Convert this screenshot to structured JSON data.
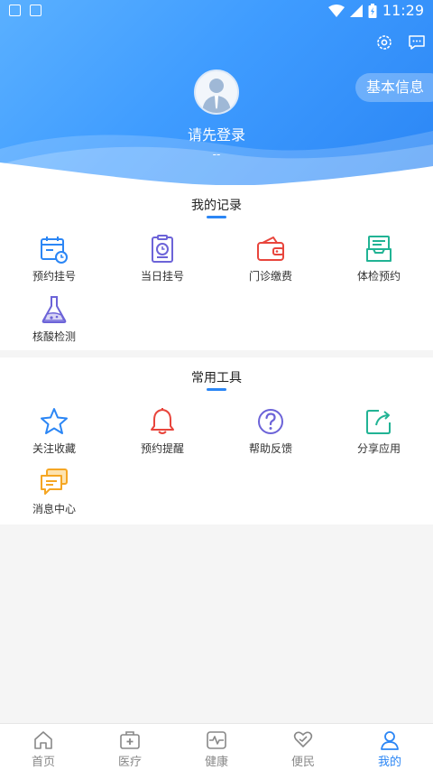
{
  "statusbar": {
    "time": "11:29"
  },
  "header": {
    "basic_info_label": "基本信息",
    "login_prompt": "请先登录",
    "subtext": "--"
  },
  "records": {
    "title": "我的记录",
    "items": [
      {
        "label": "预约挂号",
        "icon": "calendar-clock-icon",
        "color": "#2b86f5"
      },
      {
        "label": "当日挂号",
        "icon": "clock-board-icon",
        "color": "#6c63d8"
      },
      {
        "label": "门诊缴费",
        "icon": "wallet-icon",
        "color": "#e8453c"
      },
      {
        "label": "体检预约",
        "icon": "tray-doc-icon",
        "color": "#21b394"
      },
      {
        "label": "核酸检测",
        "icon": "flask-icon",
        "color": "#6c63d8"
      }
    ]
  },
  "tools": {
    "title": "常用工具",
    "items": [
      {
        "label": "关注收藏",
        "icon": "star-icon",
        "color": "#2b86f5"
      },
      {
        "label": "预约提醒",
        "icon": "bell-icon",
        "color": "#e8453c"
      },
      {
        "label": "帮助反馈",
        "icon": "question-icon",
        "color": "#6c63d8"
      },
      {
        "label": "分享应用",
        "icon": "share-icon",
        "color": "#21b394"
      },
      {
        "label": "消息中心",
        "icon": "message-icon",
        "color": "#f5a623"
      }
    ]
  },
  "tabbar": {
    "tabs": [
      {
        "label": "首页",
        "icon": "home-icon",
        "active": false
      },
      {
        "label": "医疗",
        "icon": "medical-kit-icon",
        "active": false
      },
      {
        "label": "健康",
        "icon": "heartbeat-icon",
        "active": false
      },
      {
        "label": "便民",
        "icon": "heart-hand-icon",
        "active": false
      },
      {
        "label": "我的",
        "icon": "person-icon",
        "active": true
      }
    ]
  },
  "colors": {
    "primary": "#2b86f5",
    "header_light": "#5ab0ff"
  }
}
